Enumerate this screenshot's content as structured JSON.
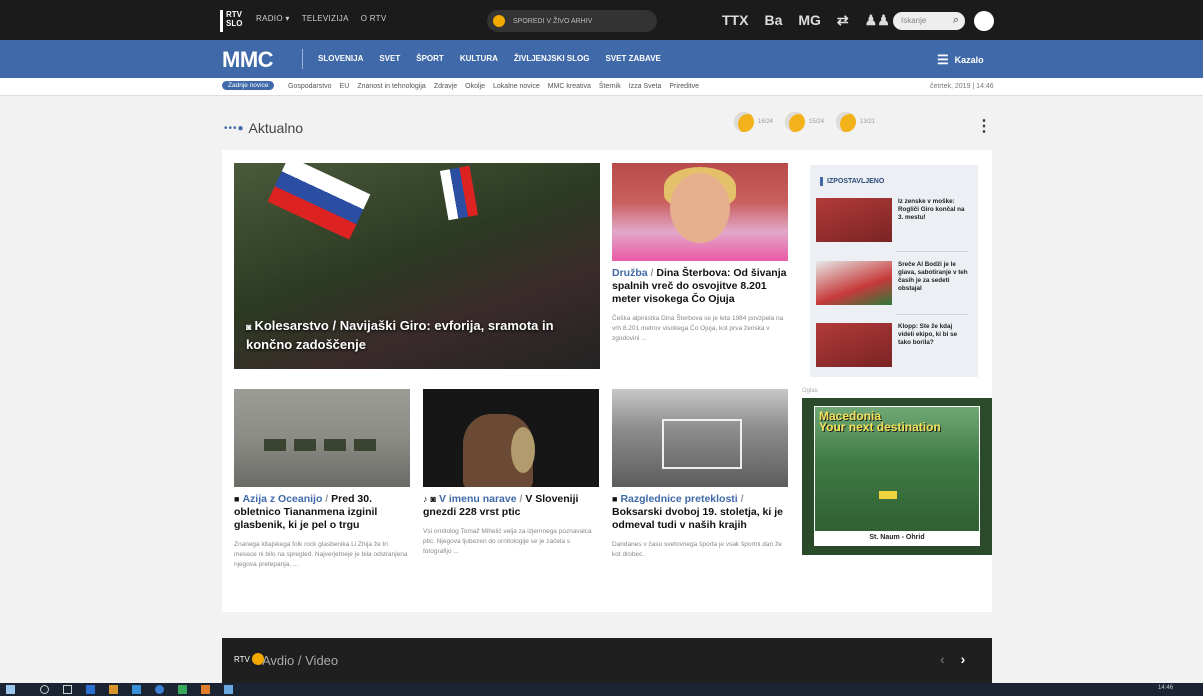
{
  "top": {
    "links": [
      "RADIO ▾",
      "TELEVIZIJA",
      "O RTV"
    ],
    "live_text": "SPOREDI  V ŽIVO  ARHIV",
    "icons": [
      "TTX",
      "Ba",
      "MG"
    ],
    "search_placeholder": "Iskanje"
  },
  "nav": {
    "brand": "MMC",
    "items": [
      "SLOVENIJA",
      "SVET",
      "ŠPORT",
      "KULTURA",
      "ŽIVLJENJSKI SLOG",
      "SVET ZABAVE"
    ],
    "menu_label": "Kazalo"
  },
  "subnav": {
    "pill": "Zadnje novice",
    "links": [
      "Gospodarstvo",
      "EU",
      "Znanost in tehnologija",
      "Zdravje",
      "Okolje",
      "Lokalne novice",
      "MMC kreativa",
      "Šternik",
      "Izza Sveta",
      "Prireditve"
    ],
    "date": "četrtek, 2019 | 14:46"
  },
  "aktualno": {
    "label": "Aktualno",
    "dots": "•••●",
    "more": "⋮"
  },
  "weather": [
    {
      "temp": "16/24",
      "desc": "delno oblačno"
    },
    {
      "temp": "15/24",
      "desc": "delno oblačno"
    },
    {
      "temp": "13/21",
      "desc": "ploha"
    }
  ],
  "main_story": {
    "category": "Kolesarstvo",
    "title": "Navijaški Giro: evforija, sramota in končno zadoščenje"
  },
  "story2": {
    "category": "Družba",
    "title": "Dina Šterbova: Od šivanja spalnih vreč do osvojitve 8.201 meter visokega Čo Ojuja",
    "body": "Češka alpinistka Dina Šterbova se je leta 1984 povzpela na vrh 8.201 metrov visokega Čo Ojuja, kot prva ženska v zgodovini ..."
  },
  "story3": {
    "category": "Azija z Oceanijo",
    "title": "Pred 30. obletnico Tiananmena izginil glasbenik, ki je pel o trgu",
    "body": "Znanega kitajskega folk rock glasbenika Li Zhija že tri mesece ni bilo na spregled. Najverjetneje je bila odstranjena njegova pretepanja, ..."
  },
  "story4": {
    "category": "V imenu narave",
    "title": "V Sloveniji gnezdi 228 vrst ptic",
    "body": "Vsi ornitolog Tomaž Mihelič velja za izjemnega poznavalca ptic. Njegova ljubezen do ornitologije se je začela s fotografijo ..."
  },
  "story5": {
    "category": "Razglednice preteklosti",
    "title": "Boksarski dvoboj 19. stoletja, ki je odmeval tudi v naših krajih",
    "body": "Dandanes v času svetovnega športa je vsak športni dan že kot drobec."
  },
  "izpostavljeno": {
    "heading": "IZPOSTAVLJENO",
    "items": [
      "Iz zenske v moške: Rogliči Giro končal na 3. mestu!",
      "Sreče Al Bodži je le glava, sabotiranje v teh časih je za sedeti obstajal",
      "Klopp: Ste že kdaj videli ekipo, ki bi se tako borila?"
    ]
  },
  "ad": {
    "label": "Oglas",
    "title_line1": "Macedonia",
    "title_line2": "Your next destination",
    "caption": "St. Naum - Ohrid"
  },
  "av": {
    "logo": "RTV",
    "title": "Avdio / Video",
    "prev": "‹",
    "next": "›"
  },
  "tray": {
    "time": "14:46"
  }
}
